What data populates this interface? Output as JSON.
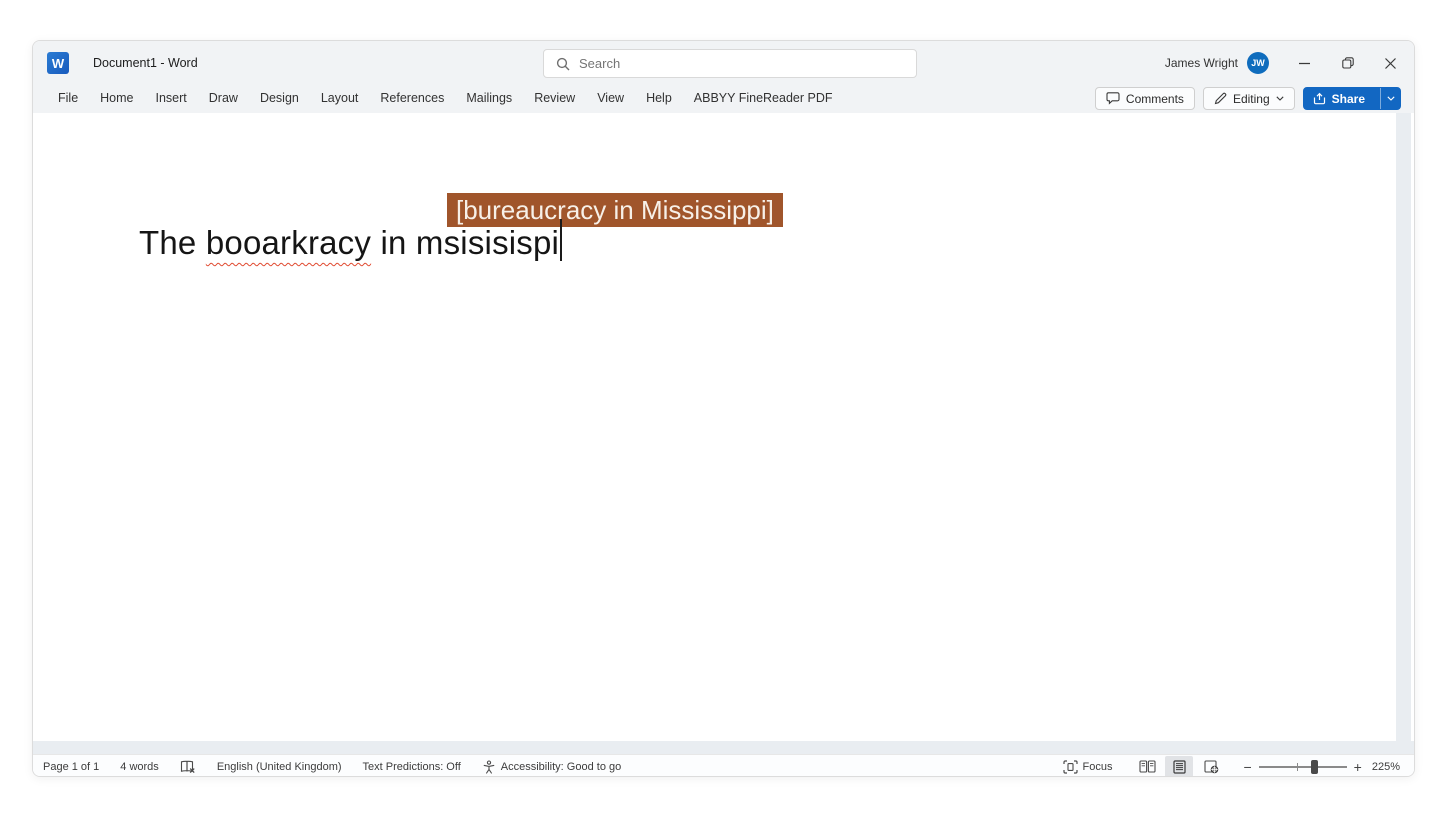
{
  "titlebar": {
    "title": "Document1  -  Word",
    "search_placeholder": "Search",
    "user_name": "James Wright",
    "user_initials": "JW"
  },
  "ribbon": {
    "tabs": [
      "File",
      "Home",
      "Insert",
      "Draw",
      "Design",
      "Layout",
      "References",
      "Mailings",
      "Review",
      "View",
      "Help",
      "ABBYY FineReader PDF"
    ],
    "comments_label": "Comments",
    "editing_label": "Editing",
    "share_label": "Share"
  },
  "document": {
    "suggestion_text": "[bureaucracy in Mississippi]",
    "line": {
      "before": "The ",
      "misspelled": "booarkracy",
      "after": " in msisisispi"
    }
  },
  "statusbar": {
    "page_indicator": "Page 1 of 1",
    "word_count": "4 words",
    "language": "English (United Kingdom)",
    "text_predictions": "Text Predictions: Off",
    "accessibility": "Accessibility: Good to go",
    "focus_label": "Focus",
    "zoom_level": "225%"
  },
  "colors": {
    "suggestion_bg": "#a0552b",
    "squiggle": "#e0492f",
    "share_button": "#1267c2",
    "avatar_bg": "#0f6cbd"
  }
}
